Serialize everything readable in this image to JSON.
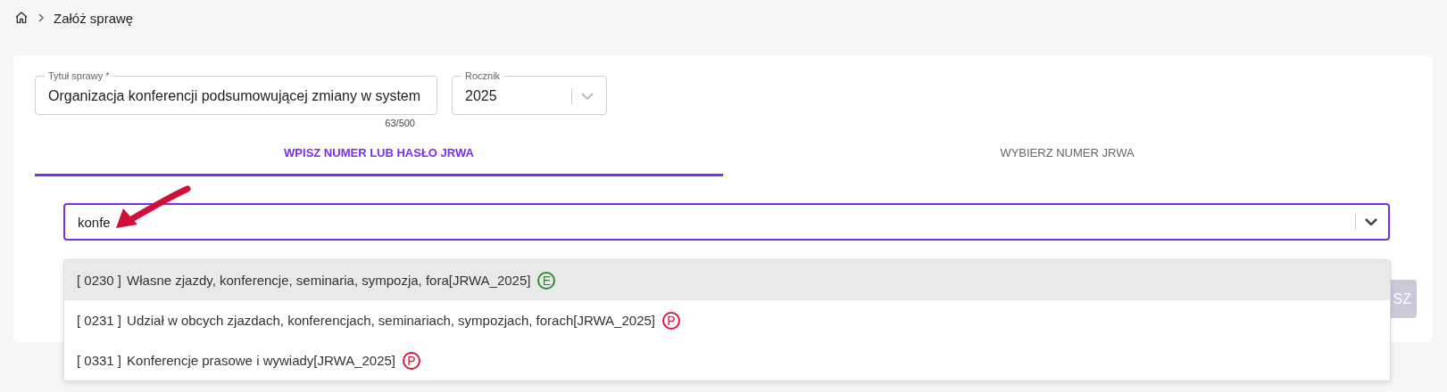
{
  "breadcrumb": {
    "current": "Załóż sprawę"
  },
  "title_field": {
    "label": "Tytuł sprawy *",
    "value": "Organizacja konferencji podsumowującej zmiany w system",
    "counter": "63/500"
  },
  "year_field": {
    "label": "Rocznik",
    "value": "2025"
  },
  "tabs": [
    {
      "label": "WPISZ NUMER LUB HASŁO JRWA",
      "selected": true
    },
    {
      "label": "WYBIERZ NUMER JRWA",
      "selected": false
    }
  ],
  "search": {
    "value": "konfe"
  },
  "options": [
    {
      "code": "[ 0230 ]",
      "text": "Własne zjazdy, konferencje, seminaria, sympozja, fora[JRWA_2025]",
      "badge": "E",
      "color": "#2e8b2e",
      "selected": true
    },
    {
      "code": "[ 0231 ]",
      "text": "Udział w obcych zjazdach, konferencjach, seminariach, sympozjach, forach[JRWA_2025]",
      "badge": "P",
      "color": "#e0143c",
      "selected": false
    },
    {
      "code": "[ 0331 ]",
      "text": "Konferencje prasowe i wywiady[JRWA_2025]",
      "badge": "P",
      "color": "#e0143c",
      "selected": false
    }
  ],
  "button": {
    "label": "SZ"
  }
}
